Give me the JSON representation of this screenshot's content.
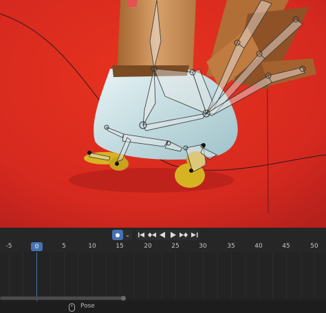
{
  "viewport": {
    "background_color": "#d6291f",
    "object_color": "#bfe0e6",
    "bone_color": "#e6e6e6"
  },
  "transport": {
    "record_icon": "record-dot-icon",
    "record_menu_icon": "chevron-down-icon",
    "buttons": [
      {
        "name": "jump-to-start-icon",
        "glyph": "⏮"
      },
      {
        "name": "jump-to-keyframe-prev-icon",
        "glyph": "◆◀"
      },
      {
        "name": "play-reverse-icon",
        "glyph": "◀"
      },
      {
        "name": "play-icon",
        "glyph": "▶"
      },
      {
        "name": "jump-to-keyframe-next-icon",
        "glyph": "▶◆"
      },
      {
        "name": "jump-to-end-icon",
        "glyph": "⏭"
      }
    ]
  },
  "timeline": {
    "current_frame": "0",
    "ticks": [
      "-5",
      "0",
      "5",
      "10",
      "15",
      "20",
      "25",
      "30",
      "35",
      "40",
      "45",
      "50"
    ]
  },
  "status_bar": {
    "mouse_icon": "mouse-icon",
    "label": "Pose"
  }
}
